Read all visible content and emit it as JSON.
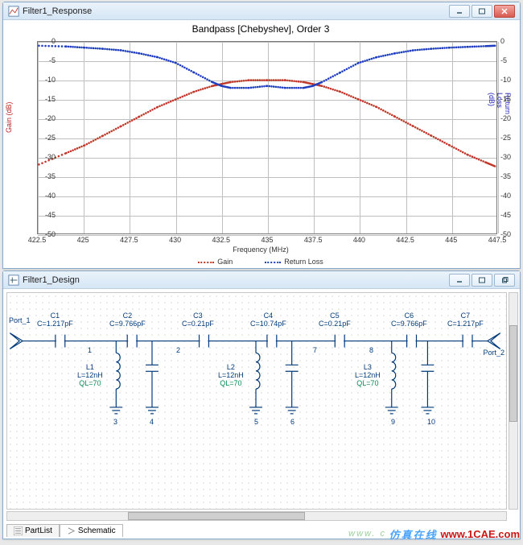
{
  "windows": {
    "response": {
      "title": "Filter1_Response"
    },
    "design": {
      "title": "Filter1_Design"
    }
  },
  "tabs": {
    "partlist": "PartList",
    "schematic": "Schematic"
  },
  "ports": {
    "in": "Port_1",
    "out": "Port_2"
  },
  "components": {
    "c1": {
      "ref": "C1",
      "val": "C=1.217pF"
    },
    "c2": {
      "ref": "C2",
      "val": "C=9.766pF"
    },
    "c3": {
      "ref": "C3",
      "val": "C=0.21pF"
    },
    "c4": {
      "ref": "C4",
      "val": "C=10.74pF"
    },
    "c5": {
      "ref": "C5",
      "val": "C=0.21pF"
    },
    "c6": {
      "ref": "C6",
      "val": "C=9.766pF"
    },
    "c7": {
      "ref": "C7",
      "val": "C=1.217pF"
    },
    "l1": {
      "ref": "L1",
      "val": "L=12nH",
      "ql": "QL=70"
    },
    "l2": {
      "ref": "L2",
      "val": "L=12nH",
      "ql": "QL=70"
    },
    "l3": {
      "ref": "L3",
      "val": "L=12nH",
      "ql": "QL=70"
    }
  },
  "node_numbers": [
    "1",
    "2",
    "3",
    "4",
    "5",
    "6",
    "7",
    "8",
    "9",
    "10"
  ],
  "chart_data": {
    "type": "line",
    "title": "Bandpass [Chebyshev], Order 3",
    "xlabel": "Frequency (MHz)",
    "ylabel_left": "Gain (dB)",
    "ylabel_right": "Return Loss (dB)",
    "xlim": [
      422.5,
      447.5
    ],
    "ylim": [
      -50,
      0
    ],
    "xticks": [
      422.5,
      425,
      427.5,
      430,
      432.5,
      435,
      437.5,
      440,
      442.5,
      445,
      447.5
    ],
    "yticks": [
      0,
      -5,
      -10,
      -15,
      -20,
      -25,
      -30,
      -35,
      -40,
      -45,
      -50
    ],
    "legend": {
      "gain": "Gain",
      "return_loss": "Return Loss"
    },
    "colors": {
      "gain": "#c0392b",
      "return_loss": "#1f3fbf"
    },
    "series": [
      {
        "name": "Gain",
        "axis": "left",
        "color": "#c0392b",
        "x": [
          422.5,
          424,
          425,
          426,
          427,
          428,
          429,
          430,
          431,
          432,
          432.5,
          433,
          434,
          435,
          436,
          437,
          437.5,
          438,
          439,
          440,
          441,
          442,
          443,
          444,
          445,
          446,
          447,
          447.5
        ],
        "y": [
          -32,
          -29,
          -27,
          -24.5,
          -22,
          -19.5,
          -17,
          -15,
          -13,
          -11.5,
          -11,
          -10.5,
          -10,
          -10,
          -10,
          -10.5,
          -11,
          -11.5,
          -13,
          -15,
          -17,
          -19.5,
          -22,
          -24.5,
          -27,
          -29.5,
          -31.5,
          -32.5
        ]
      },
      {
        "name": "Return Loss",
        "axis": "right",
        "color": "#1f3fbf",
        "x": [
          422.5,
          424,
          425,
          426,
          427,
          428,
          429,
          430,
          431,
          432,
          432.5,
          433,
          434,
          435,
          436,
          437,
          437.5,
          438,
          439,
          440,
          441,
          442,
          443,
          444,
          445,
          446,
          447,
          447.5
        ],
        "y": [
          -1,
          -1.2,
          -1.5,
          -1.8,
          -2.2,
          -3,
          -4,
          -5.5,
          -8,
          -10.5,
          -11.5,
          -12,
          -12,
          -11.5,
          -12,
          -12,
          -11.5,
          -10.5,
          -8,
          -5.5,
          -4,
          -3,
          -2.2,
          -1.8,
          -1.5,
          -1.3,
          -1.1,
          -1
        ]
      }
    ]
  },
  "watermark": {
    "zh": "仿真在线",
    "url": "www.1CAE.com",
    "leftsite": "www. c"
  }
}
